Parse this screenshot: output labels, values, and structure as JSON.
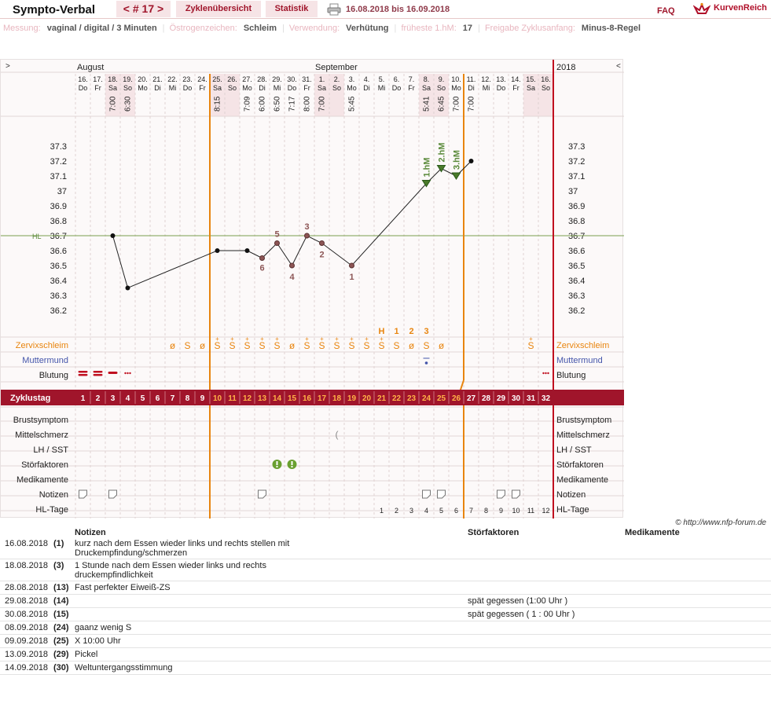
{
  "header": {
    "title": "Sympto-Verbal",
    "cycle_nav": "< # 17 >",
    "tab_overview": "Zyklenübersicht",
    "tab_stats": "Statistik",
    "date_range": "16.08.2018 bis 16.09.2018",
    "faq": "FAQ",
    "logo": "KurvenReich"
  },
  "settings": [
    {
      "label": "Messung:",
      "value": "vaginal / digital / 3 Minuten"
    },
    {
      "label": "Östrogenzeichen:",
      "value": "Schleim"
    },
    {
      "label": "Verwendung:",
      "value": "Verhütung"
    },
    {
      "label": "früheste 1.hM:",
      "value": "17"
    },
    {
      "label": "Freigabe Zyklusanfang:",
      "value": "Minus-8-Regel"
    }
  ],
  "chart": {
    "nav_prev": ">",
    "nav_next": "<",
    "months": {
      "august": "August",
      "september": "September",
      "year": "2018"
    },
    "hl_label": "HL",
    "days": [
      {
        "d": "16.",
        "w": "Do",
        "t": "",
        "z": "1",
        "hl": ""
      },
      {
        "d": "17.",
        "w": "Fr",
        "t": "",
        "z": "2",
        "hl": ""
      },
      {
        "d": "18.",
        "w": "Sa",
        "t": "7:00",
        "z": "3",
        "hl": ""
      },
      {
        "d": "19.",
        "w": "So",
        "t": "6:30",
        "z": "4",
        "hl": ""
      },
      {
        "d": "20.",
        "w": "Mo",
        "t": "",
        "z": "5",
        "hl": ""
      },
      {
        "d": "21.",
        "w": "Di",
        "t": "",
        "z": "6",
        "hl": ""
      },
      {
        "d": "22.",
        "w": "Mi",
        "t": "",
        "z": "7",
        "hl": ""
      },
      {
        "d": "23.",
        "w": "Do",
        "t": "",
        "z": "8",
        "hl": ""
      },
      {
        "d": "24.",
        "w": "Fr",
        "t": "",
        "z": "9",
        "hl": ""
      },
      {
        "d": "25.",
        "w": "Sa",
        "t": "8:15",
        "z": "10",
        "hl": ""
      },
      {
        "d": "26.",
        "w": "So",
        "t": "",
        "z": "11",
        "hl": ""
      },
      {
        "d": "27.",
        "w": "Mo",
        "t": "7:09",
        "z": "12",
        "hl": ""
      },
      {
        "d": "28.",
        "w": "Di",
        "t": "6:00",
        "z": "13",
        "hl": ""
      },
      {
        "d": "29.",
        "w": "Mi",
        "t": "6:50",
        "z": "14",
        "hl": ""
      },
      {
        "d": "30.",
        "w": "Do",
        "t": "7:17",
        "z": "15",
        "hl": ""
      },
      {
        "d": "31.",
        "w": "Fr",
        "t": "8:00",
        "z": "16",
        "hl": ""
      },
      {
        "d": "1.",
        "w": "Sa",
        "t": "7:00",
        "z": "17",
        "hl": ""
      },
      {
        "d": "2.",
        "w": "So",
        "t": "",
        "z": "18",
        "hl": ""
      },
      {
        "d": "3.",
        "w": "Mo",
        "t": "5:45",
        "z": "19",
        "hl": ""
      },
      {
        "d": "4.",
        "w": "Di",
        "t": "",
        "z": "20",
        "hl": ""
      },
      {
        "d": "5.",
        "w": "Mi",
        "t": "",
        "z": "21",
        "hl": "1"
      },
      {
        "d": "6.",
        "w": "Do",
        "t": "",
        "z": "22",
        "hl": "2"
      },
      {
        "d": "7.",
        "w": "Fr",
        "t": "",
        "z": "23",
        "hl": "3"
      },
      {
        "d": "8.",
        "w": "Sa",
        "t": "5:41",
        "z": "24",
        "hl": "4"
      },
      {
        "d": "9.",
        "w": "So",
        "t": "6:45",
        "z": "25",
        "hl": "5"
      },
      {
        "d": "10.",
        "w": "Mo",
        "t": "7:00",
        "z": "26",
        "hl": "6"
      },
      {
        "d": "11.",
        "w": "Di",
        "t": "7:00",
        "z": "27",
        "hl": "7"
      },
      {
        "d": "12.",
        "w": "Mi",
        "t": "",
        "z": "28",
        "hl": "8"
      },
      {
        "d": "13.",
        "w": "Do",
        "t": "",
        "z": "29",
        "hl": "9"
      },
      {
        "d": "14.",
        "w": "Fr",
        "t": "",
        "z": "30",
        "hl": "10"
      },
      {
        "d": "15.",
        "w": "Sa",
        "t": "",
        "z": "31",
        "hl": "11"
      },
      {
        "d": "16.",
        "w": "So",
        "t": "",
        "z": "32",
        "hl": "12"
      }
    ],
    "y_ticks": [
      "37.3",
      "37.2",
      "37.1",
      "37",
      "36.9",
      "36.8",
      "36.7",
      "36.6",
      "36.5",
      "36.4",
      "36.3",
      "36.2"
    ],
    "row_labels": {
      "zervix": "Zervixschleim",
      "muttermund": "Muttermund",
      "blutung": "Blutung",
      "zyklustag": "Zyklustag",
      "brust": "Brustsymptom",
      "mittelschmerz": "Mittelschmerz",
      "lh": "LH / SST",
      "stoer": "Störfaktoren",
      "medi": "Medikamente",
      "notizen": "Notizen",
      "hl_tage": "HL-Tage"
    },
    "peak_letters": [
      "H",
      "1",
      "2",
      "3"
    ],
    "mucus": [
      "",
      "",
      "",
      "",
      "",
      "",
      "ø",
      "S",
      "ø",
      "S+",
      "S+",
      "S+",
      "S+",
      "S+",
      "ø",
      "S+",
      "S+",
      "S+",
      "S+",
      "S+",
      "S+",
      "S",
      "ø",
      "S",
      "ø",
      "",
      "",
      "",
      "",
      "",
      "S+",
      ""
    ],
    "hm_labels": [
      "1.hM",
      "2.hM",
      "3.hM"
    ],
    "low_labels": [
      "6",
      "5",
      "4",
      "3",
      "2",
      "1"
    ],
    "colors": {
      "accent": "#a0152b",
      "orange": "#e8850f",
      "green": "#5a8a3a",
      "blue": "#4455aa"
    }
  },
  "chart_data": {
    "type": "line",
    "xlabel": "Zyklustag",
    "ylim": [
      36.2,
      37.3
    ],
    "x": [
      3,
      4,
      10,
      12,
      13,
      14,
      15,
      16,
      17,
      19,
      24,
      25,
      26,
      27
    ],
    "values": [
      36.7,
      36.35,
      36.6,
      36.6,
      36.55,
      36.65,
      36.5,
      36.7,
      36.65,
      36.5,
      37.05,
      37.15,
      37.1,
      37.2
    ],
    "hl_level": 36.7
  },
  "notes": {
    "head_notes": "Notizen",
    "head_dist": "Störfaktoren",
    "head_med": "Medikamente",
    "copyright": "© http://www.nfp-forum.de",
    "rows": [
      {
        "date": "16.08.2018",
        "day": "(1)",
        "note": "kurz nach dem Essen wieder links und rechts stellen mit Druckempfindung/schmerzen",
        "dist": ""
      },
      {
        "date": "18.08.2018",
        "day": "(3)",
        "note": "1 Stunde nach dem Essen wieder links und rechts druckempfindlichkeit",
        "dist": ""
      },
      {
        "date": "28.08.2018",
        "day": "(13)",
        "note": "Fast perfekter Eiweiß-ZS",
        "dist": ""
      },
      {
        "date": "29.08.2018",
        "day": "(14)",
        "note": "",
        "dist": "spät gegessen (1:00 Uhr )"
      },
      {
        "date": "30.08.2018",
        "day": "(15)",
        "note": "",
        "dist": "spät gegessen ( 1 : 00 Uhr )"
      },
      {
        "date": "08.09.2018",
        "day": "(24)",
        "note": "gaanz wenig S",
        "dist": ""
      },
      {
        "date": "09.09.2018",
        "day": "(25)",
        "note": "X 10:00 Uhr",
        "dist": ""
      },
      {
        "date": "13.09.2018",
        "day": "(29)",
        "note": "Pickel",
        "dist": ""
      },
      {
        "date": "14.09.2018",
        "day": "(30)",
        "note": "Weltuntergangsstimmung",
        "dist": ""
      }
    ]
  }
}
